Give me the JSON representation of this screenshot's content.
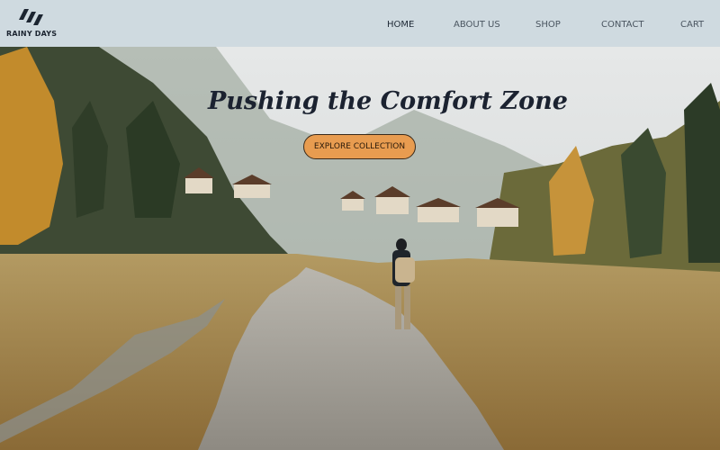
{
  "brand": {
    "name": "RAINY DAYS",
    "logo_icon": "rain-drops-logo-icon"
  },
  "nav": {
    "items": [
      {
        "label": "HOME",
        "active": true
      },
      {
        "label": "ABOUT US",
        "active": false
      },
      {
        "label": "SHOP",
        "active": false
      },
      {
        "label": "CONTACT",
        "active": false
      },
      {
        "label": "CART",
        "active": false
      }
    ]
  },
  "hero": {
    "title": "Pushing the Comfort Zone",
    "cta_label": "EXPLORE COLLECTION",
    "image_description_icon": "mountain-path-hiker-photo"
  },
  "colors": {
    "header_bg": "#cfdae0",
    "cta_bg": "#e89c50",
    "title_text": "#1b2230"
  }
}
